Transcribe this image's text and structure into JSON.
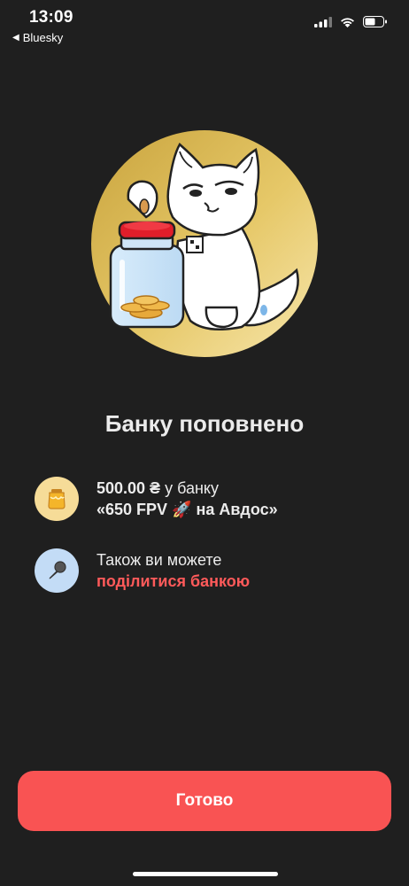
{
  "status_bar": {
    "time": "13:09",
    "back_app": "Bluesky",
    "icons": [
      "cellular-icon",
      "wifi-icon",
      "battery-icon"
    ]
  },
  "hero": {
    "image": "cat-with-coin-jar-illustration"
  },
  "title": "Банку поповнено",
  "deposit": {
    "amount": "500.00 ₴",
    "amount_suffix": " у банку",
    "jar_name": "«650 FPV 🚀 на Авдос»",
    "icon": "honey-jar-icon"
  },
  "share": {
    "text": "Також ви можете",
    "link": "поділитися банкою",
    "icon": "microphone-icon"
  },
  "done_button": "Готово",
  "colors": {
    "background": "#1f1f1f",
    "accent": "#f95353",
    "link": "#ff5a5a",
    "hero_gold": "#e0bf5c"
  }
}
